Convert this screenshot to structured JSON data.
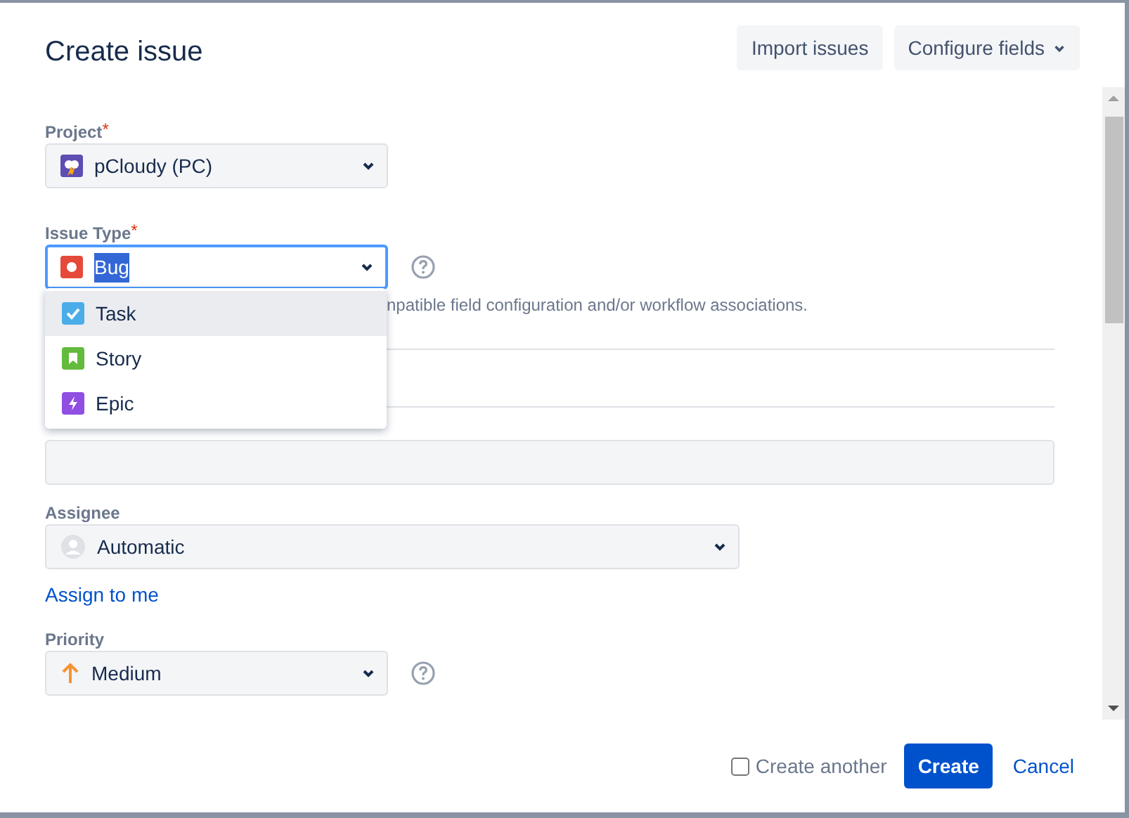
{
  "dialog": {
    "title": "Create issue",
    "header_buttons": [
      {
        "label": "Import issues",
        "kind": "plain"
      },
      {
        "label": "Configure fields",
        "kind": "menu"
      }
    ],
    "fields": [
      {
        "kind": "select",
        "label": "Project",
        "required_mark": "*",
        "value": "pCloudy (PC)"
      },
      {
        "kind": "select",
        "label": "Issue Type",
        "required_mark": "*",
        "value": "Bug",
        "value_highlighted": true,
        "focused": true,
        "help": true,
        "note": "npatible field configuration and/or workflow associations.",
        "options": [
          {
            "label": "Task",
            "color": "#4bade8",
            "selected": true
          },
          {
            "label": "Story",
            "color": "#63ba3c",
            "selected": false
          },
          {
            "label": "Epic",
            "color": "#904ee2",
            "selected": false
          }
        ]
      },
      {
        "kind": "divider"
      },
      {
        "kind": "text"
      },
      {
        "kind": "user_select",
        "label": "Assignee",
        "value": "Automatic",
        "link": "Assign to me"
      },
      {
        "kind": "select",
        "label": "Priority",
        "value": "Medium",
        "help": true
      }
    ],
    "footer": {
      "checkbox": {
        "label": "Create another",
        "checked": false
      },
      "primary": "Create",
      "cancel": "Cancel"
    }
  }
}
